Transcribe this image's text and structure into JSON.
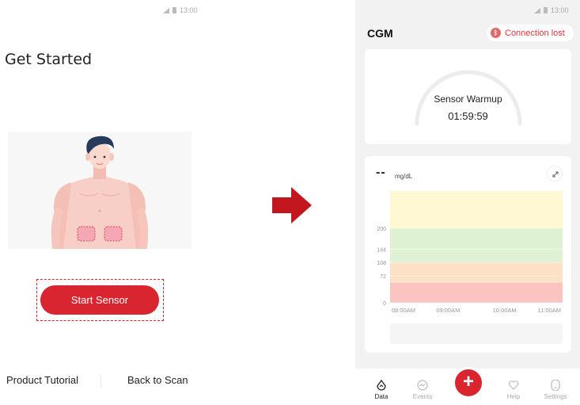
{
  "left_screen": {
    "status_time": "13:00",
    "title": "Get Started",
    "start_button_label": "Start Sensor",
    "product_tutorial_label": "Product Tutorial",
    "back_to_scan_label": "Back to Scan"
  },
  "right_screen": {
    "status_time": "13:00",
    "app_title": "CGM",
    "connection_icon": "bluetooth-icon",
    "connection_label": "Connection lost",
    "warmup": {
      "title": "Sensor Warmup",
      "time_remaining": "01:59:59"
    },
    "glucose": {
      "value": "--",
      "unit": "mg/dL"
    },
    "tabs": [
      {
        "label": "Data",
        "icon": "data-icon"
      },
      {
        "label": "Events",
        "icon": "events-icon"
      },
      {
        "label": "Help",
        "icon": "help-icon"
      },
      {
        "label": "Settings",
        "icon": "settings-icon"
      }
    ],
    "add_button_label": "+"
  },
  "chart_data": {
    "type": "line",
    "title": "",
    "xlabel": "",
    "ylabel": "",
    "x_ticks": [
      "08:00AM",
      "09:00AM",
      "10:00AM",
      "11:00AM"
    ],
    "y_ticks": [
      0,
      72,
      108,
      144,
      200
    ],
    "ylim": [
      0,
      300
    ],
    "bands": [
      {
        "from": 0,
        "to": 54,
        "color": "#fbc4c0"
      },
      {
        "from": 54,
        "to": 108,
        "color": "#fde0c6"
      },
      {
        "from": 108,
        "to": 200,
        "color": "#dff1d3"
      },
      {
        "from": 200,
        "to": 300,
        "color": "#fff8d2"
      }
    ],
    "series": [],
    "grid": true
  },
  "colors": {
    "accent": "#d9252f",
    "connection_lost": "#e0303a"
  }
}
